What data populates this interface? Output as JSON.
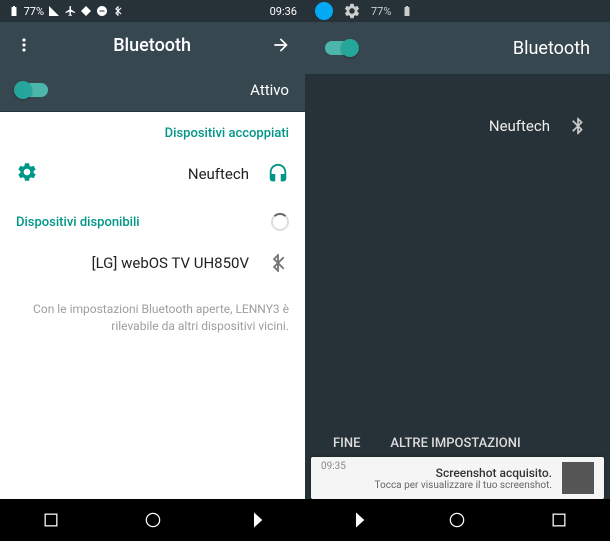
{
  "left": {
    "statusbar": {
      "time": "09:36",
      "battery": "77%"
    },
    "title": "Bluetooth",
    "toggle_label": "Attivo",
    "paired_header": "Dispositivi accoppiati",
    "paired_device": "Neuftech",
    "available_header": "Dispositivi disponibili",
    "available_device": "[LG] webOS TV UH850V",
    "note": "Con le impostazioni Bluetooth aperte, LENNY3 è rilevabile da altri dispositivi vicini."
  },
  "right": {
    "statusbar": {
      "battery": "77%"
    },
    "title": "Bluetooth",
    "device": "Neuftech",
    "action_fine": "FINE",
    "action_altre": "ALTRE IMPOSTAZIONI",
    "notif_title": "Screenshot acquisito.",
    "notif_sub": "Tocca per visualizzare il tuo screenshot.",
    "notif_time": "09:35"
  },
  "colors": {
    "accent": "#009688",
    "dark": "#37474f",
    "darker": "#263238"
  }
}
